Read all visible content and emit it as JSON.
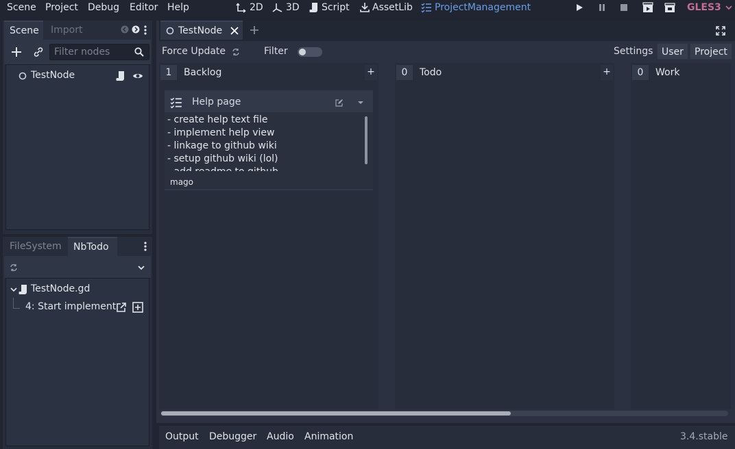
{
  "menu": {
    "items": [
      "Scene",
      "Project",
      "Debug",
      "Editor",
      "Help"
    ]
  },
  "workspaces": {
    "btn_2d": "2D",
    "btn_3d": "3D",
    "btn_script": "Script",
    "btn_assetlib": "AssetLib",
    "btn_projectmanagement": "ProjectManagement"
  },
  "renderer": {
    "label": "GLES3",
    "color": "#c26d93"
  },
  "scene_dock": {
    "tabs": [
      "Scene",
      "Import"
    ],
    "filter_placeholder": "Filter nodes",
    "tree": [
      {
        "label": "TestNode"
      }
    ]
  },
  "filesystem_dock": {
    "tabs": [
      "FileSystem",
      "NbTodo"
    ],
    "tree": [
      {
        "label": "TestNode.gd"
      },
      {
        "label": "4: Start implement"
      }
    ]
  },
  "editor": {
    "open_tab": "TestNode",
    "toolbar": {
      "force_update": "Force Update",
      "filter_label": "Filter",
      "filter_on": false,
      "settings_label": "Settings",
      "user_btn": "User",
      "project_btn": "Project"
    },
    "columns": [
      {
        "count": "1",
        "title": "Backlog",
        "add": "+",
        "cards": [
          {
            "title": "Help page",
            "lines": [
              "- create help text file",
              "- implement help view",
              "- linkage to github wiki",
              "- setup github wiki (lol)",
              "- add readme to github"
            ],
            "author": "mago"
          }
        ]
      },
      {
        "count": "0",
        "title": "Todo",
        "add": "+"
      },
      {
        "count": "0",
        "title": "Work"
      }
    ]
  },
  "bottom_panel": {
    "tabs": [
      "Output",
      "Debugger",
      "Audio",
      "Animation"
    ],
    "version": "3.4.stable"
  },
  "colors": {
    "accent": "#6b9ce4",
    "background": "#202531",
    "panel": "#2b3140"
  }
}
